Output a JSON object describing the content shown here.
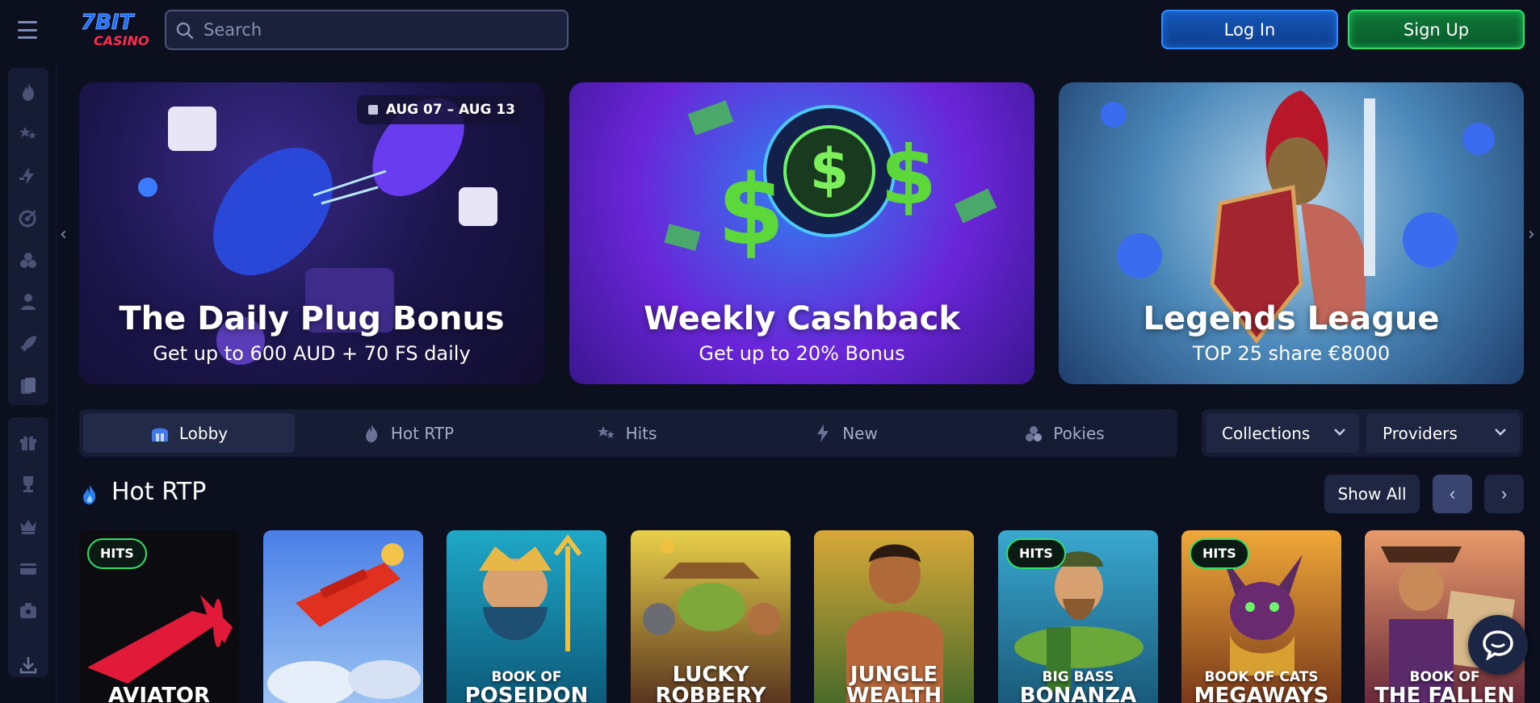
{
  "header": {
    "logo_text": "7BIT CASINO",
    "search_placeholder": "Search",
    "login_label": "Log In",
    "signup_label": "Sign Up"
  },
  "sidebar": {
    "icons": [
      "flame-icon",
      "stars-icon",
      "lightning-icon",
      "target-icon",
      "cherries-icon",
      "live-dealer-icon",
      "rocket-icon",
      "cards-icon",
      "gift-icon",
      "trophy-icon",
      "crown-icon",
      "wallet-icon",
      "vip-icon",
      "download-icon"
    ]
  },
  "banners": [
    {
      "title": "The Daily Plug Bonus",
      "subtitle": "Get up to 600 AUD + 70 FS daily",
      "date": "AUG 07 – AUG 13"
    },
    {
      "title": "Weekly Cashback",
      "subtitle": "Get up to 20% Bonus"
    },
    {
      "title": "Legends League",
      "subtitle": "TOP 25 share €8000"
    }
  ],
  "tabs": [
    {
      "label": "Lobby",
      "icon": "lobby-icon",
      "active": true
    },
    {
      "label": "Hot RTP",
      "icon": "flame-icon"
    },
    {
      "label": "Hits",
      "icon": "stars-icon"
    },
    {
      "label": "New",
      "icon": "lightning-icon"
    },
    {
      "label": "Pokies",
      "icon": "cherries-icon"
    }
  ],
  "filters": {
    "collections": "Collections",
    "providers": "Providers"
  },
  "section": {
    "title": "Hot RTP",
    "show_all": "Show All"
  },
  "games": [
    {
      "name_top": "",
      "name": "AVIATOR",
      "badge": "HITS"
    },
    {
      "name_top": "",
      "name": "",
      "badge": ""
    },
    {
      "name_top": "BOOK OF",
      "name": "POSEIDON",
      "badge": ""
    },
    {
      "name_top": "LUCKY",
      "name": "ROBBERY",
      "badge": ""
    },
    {
      "name_top": "JUNGLE",
      "name": "WEALTH",
      "badge": ""
    },
    {
      "name_top": "BIG BASS",
      "name": "BONANZA",
      "badge": "HITS"
    },
    {
      "name_top": "BOOK OF CATS",
      "name": "MEGAWAYS",
      "badge": "HITS"
    },
    {
      "name_top": "BOOK OF",
      "name": "THE FALLEN",
      "badge": ""
    }
  ],
  "colors": {
    "background": "#0b0f1e",
    "panel": "#161c33",
    "login_accent": "#2f8bff",
    "signup_accent": "#2fe06a",
    "hits_badge": "#2fe06a"
  }
}
